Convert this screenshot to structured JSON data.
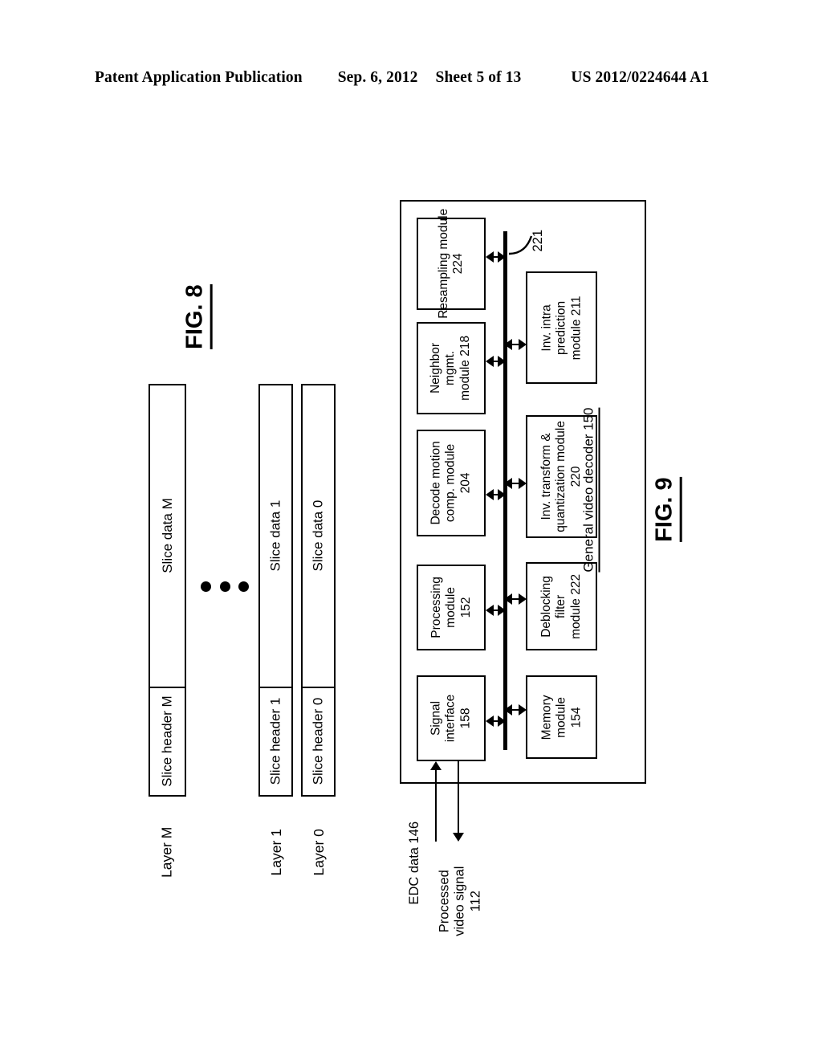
{
  "header": {
    "publication": "Patent Application Publication",
    "date": "Sep. 6, 2012",
    "sheet": "Sheet 5 of 13",
    "patent_number": "US 2012/0224644 A1"
  },
  "fig8": {
    "caption": "FIG. 8",
    "ellipsis": "•••",
    "layers": [
      {
        "label": "Layer M",
        "header": "Slice header M",
        "data": "Slice data M"
      },
      {
        "label": "Layer 1",
        "header": "Slice header 1",
        "data": "Slice data 1"
      },
      {
        "label": "Layer 0",
        "header": "Slice header 0",
        "data": "Slice data 0"
      }
    ]
  },
  "fig9": {
    "caption": "FIG. 9",
    "container_label": "General video decoder 150",
    "bus_reference": "221",
    "modules": {
      "resampling": "Resampling module 224",
      "neighbor_mgmt": "Neighbor mgmt. module 218",
      "decode_motion_comp": "Decode motion comp. module 204",
      "processing": "Processing module 152",
      "signal_interface": "Signal interface 158",
      "inv_intra_prediction": "Inv. intra prediction module 211",
      "inv_transform_quant": "Inv. transform & quantization module 220",
      "deblocking_filter": "Deblocking filter module 222",
      "memory": "Memory module 154"
    },
    "io": {
      "input": "EDC data 146",
      "output": "Processed video signal 112"
    }
  },
  "colors": {
    "ink": "#000000",
    "page": "#ffffff"
  }
}
